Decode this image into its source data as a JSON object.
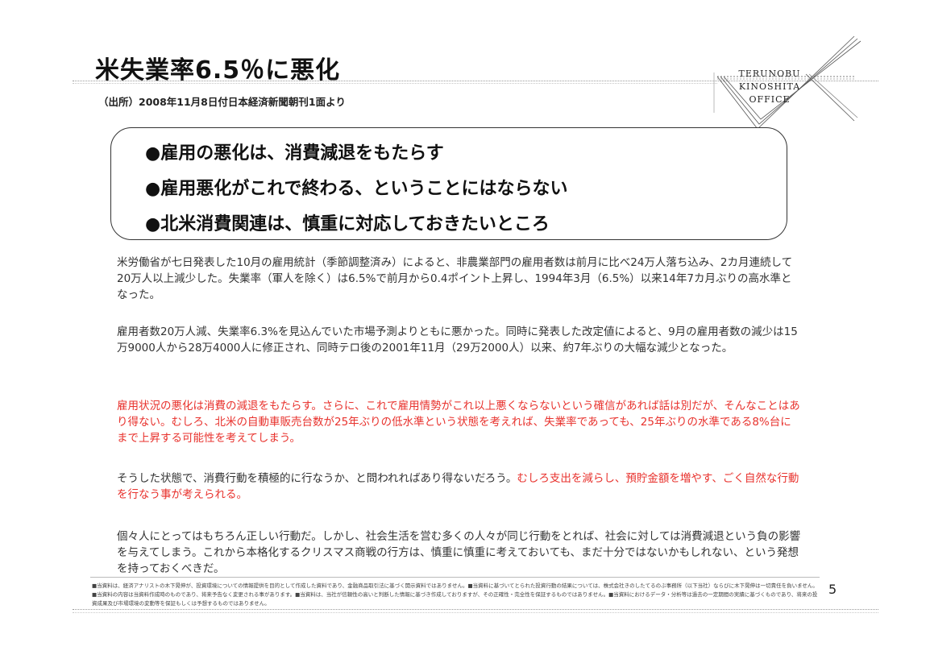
{
  "header": {
    "title": "米失業率6.5％に悪化",
    "source": "（出所）2008年11月8日付日本経済新聞朝刊1面より"
  },
  "logo": {
    "line1": "TERUNOBU",
    "line2": "KINOSHITA",
    "line3": "OFFICE"
  },
  "summary": {
    "items": [
      "●雇用の悪化は、消費減退をもたらす",
      "●雇用悪化がこれで終わる、ということにはならない",
      "●北米消費関連は、慎重に対応しておきたいところ"
    ]
  },
  "body": {
    "p1": "米労働省が七日発表した10月の雇用統計（季節調整済み）によると、非農業部門の雇用者数は前月に比べ24万人落ち込み、2カ月連続して20万人以上減少した。失業率（軍人を除く）は6.5%で前月から0.4ポイント上昇し、1994年3月（6.5%）以来14年7カ月ぶりの高水準となった。",
    "p2": "雇用者数20万人減、失業率6.3%を見込んでいた市場予測よりともに悪かった。同時に発表した改定値によると、9月の雇用者数の減少は15万9000人から28万4000人に修正され、同時テロ後の2001年11月（29万2000人）以来、約7年ぶりの大幅な減少となった。",
    "p3": "雇用状況の悪化は消費の減退をもたらす。さらに、これで雇用情勢がこれ以上悪くならないという確信があれば話は別だが、そんなことはあり得ない。むしろ、北米の自動車販売台数が25年ぶりの低水準という状態を考えれば、失業率であっても、25年ぶりの水準である8%台にまで上昇する可能性を考えてしまう。",
    "p4_normal": "そうした状態で、消費行動を積極的に行なうか、と問われればあり得ないだろう。",
    "p4_red": "むしろ支出を減らし、預貯金額を増やす、ごく自然な行動を行なう事が考えられる。",
    "p5": "個々人にとってはもちろん正しい行動だ。しかし、社会生活を営む多くの人々が同じ行動をとれば、社会に対しては消費減退という負の影響を与えてしまう。これから本格化するクリスマス商戦の行方は、慎重に慎重に考えておいても、まだ十分ではないかもしれない、という発想を持っておくべきだ。"
  },
  "footer": {
    "disclaimer_line1": "■当資料は、経済アナリストの木下晃伸が、投資環境についての情報提供を目的として作成した資料であり、金融商品取引法に基づく開示資料ではありません。■当資料に基づいてとられた投資行動の結果については、株式会社きのしたてるのぶ事務所（以下当社）ならびに木下晃伸は一切責任を負いません。■当資料の内容は当資料作成時のものであり、将来予告なく変更される事があります。■当資料は、当社が信頼性の高いと判断した情報に基づき作成しておりますが、その正確性・完全性を保証するものではありません。■当資料におけるデータ・分析等は過去の一定期間の実績に基づくものであり、将来の投資成果及び市場環境の変動等を保証もしくは予想するものではありません。",
    "page_number": "5"
  }
}
